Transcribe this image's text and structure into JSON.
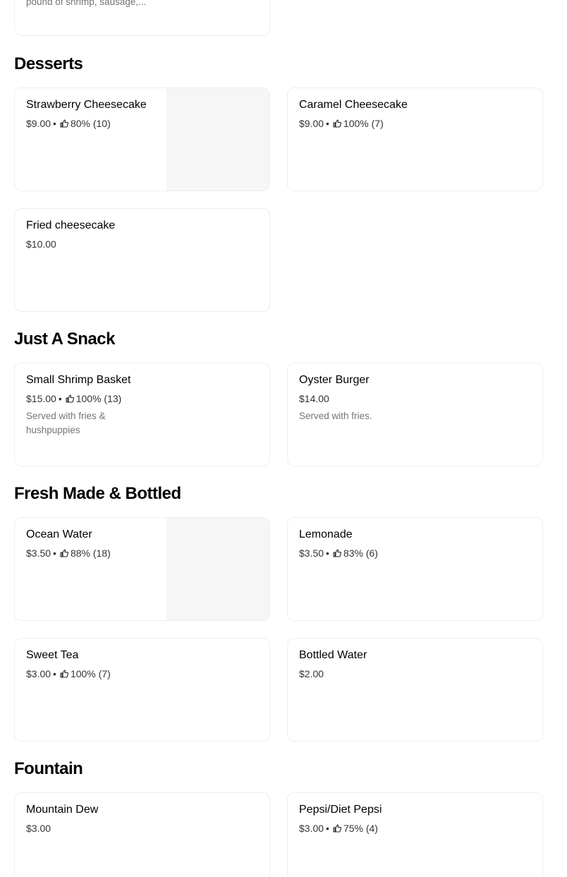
{
  "top_card": {
    "description": "pound of shrimp, sausage,..."
  },
  "sections": {
    "desserts": {
      "title": "Desserts"
    },
    "snack": {
      "title": "Just A Snack"
    },
    "fresh": {
      "title": "Fresh Made & Bottled"
    },
    "fountain": {
      "title": "Fountain"
    }
  },
  "items": {
    "strawberry_cheesecake": {
      "name": "Strawberry Cheesecake",
      "price": "$9.00",
      "sep": "•",
      "rating": "80% (10)"
    },
    "caramel_cheesecake": {
      "name": "Caramel Cheesecake",
      "price": "$9.00",
      "sep": "•",
      "rating": "100% (7)"
    },
    "fried_cheesecake": {
      "name": "Fried cheesecake",
      "price": "$10.00"
    },
    "small_shrimp_basket": {
      "name": "Small Shrimp Basket",
      "price": "$15.00",
      "sep": "•",
      "rating": "100% (13)",
      "description": "Served with fries & hushpuppies"
    },
    "oyster_burger": {
      "name": "Oyster Burger",
      "price": "$14.00",
      "description": "Served with fries."
    },
    "ocean_water": {
      "name": "Ocean Water",
      "price": "$3.50",
      "sep": "•",
      "rating": "88% (18)"
    },
    "lemonade": {
      "name": "Lemonade",
      "price": "$3.50",
      "sep": "•",
      "rating": "83% (6)"
    },
    "sweet_tea": {
      "name": "Sweet Tea",
      "price": "$3.00",
      "sep": "•",
      "rating": "100% (7)"
    },
    "bottled_water": {
      "name": "Bottled Water",
      "price": "$2.00"
    },
    "mountain_dew": {
      "name": "Mountain Dew",
      "price": "$3.00"
    },
    "pepsi": {
      "name": "Pepsi/Diet Pepsi",
      "price": "$3.00",
      "sep": "•",
      "rating": "75% (4)"
    }
  },
  "icons": {
    "rating": "thumbs-up-icon"
  },
  "colors": {
    "card_border": "#eeeeee",
    "image_placeholder": "#f6f6f6",
    "description_text": "#757575"
  }
}
